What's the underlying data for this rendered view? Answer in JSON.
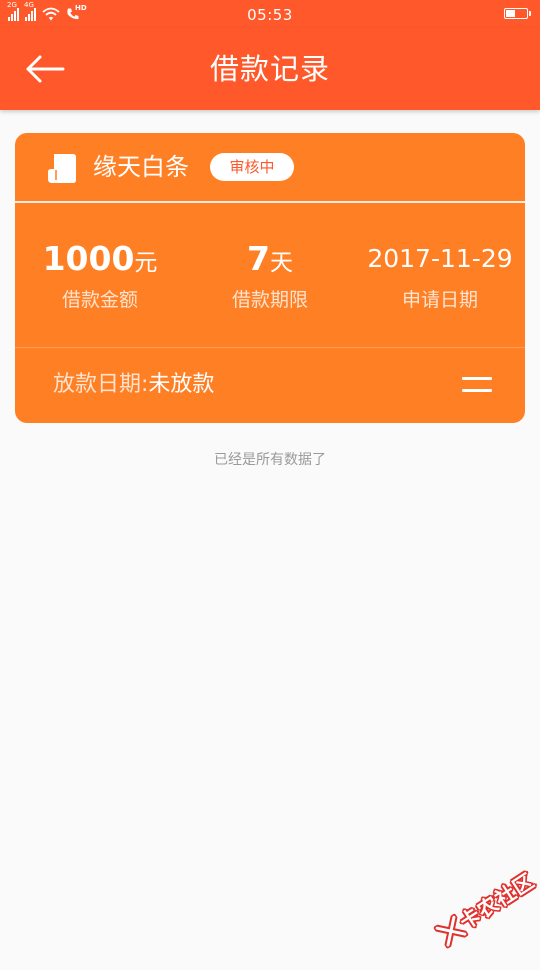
{
  "status_bar": {
    "time": "05:53",
    "network_2g": "2G",
    "network_4g": "4G",
    "hd_label": "HD",
    "battery_level": 0.45
  },
  "header": {
    "title": "借款记录"
  },
  "loan_card": {
    "product_name": "缘天白条",
    "status": "审核中",
    "amount": {
      "value": "1000",
      "unit": "元",
      "label": "借款金额"
    },
    "term": {
      "value": "7",
      "unit": "天",
      "label": "借款期限"
    },
    "apply_date": {
      "value": "2017-11-29",
      "label": "申请日期"
    },
    "disbursement": {
      "label": "放款日期:",
      "value": "未放款"
    }
  },
  "list_end_text": "已经是所有数据了",
  "watermark": {
    "text": "卡农社区"
  },
  "colors": {
    "primary": "#ff582b",
    "card": "#ff7f24",
    "background": "#fafafa"
  }
}
